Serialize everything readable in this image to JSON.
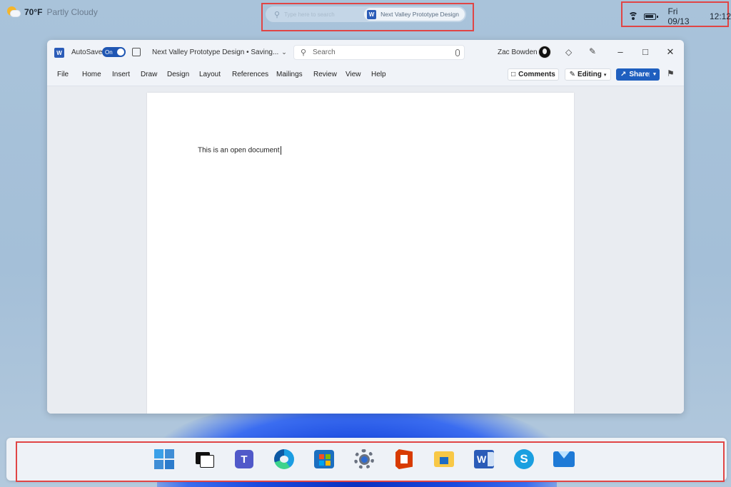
{
  "weather": {
    "temperature": "70°F",
    "condition": "Partly Cloudy"
  },
  "top_search": {
    "placeholder": "Type here to search",
    "active_doc": "Next Valley Prototype Design"
  },
  "tray": {
    "date": "Fri 09/13",
    "time": "12:12"
  },
  "word": {
    "autosave_label": "AutoSave",
    "autosave_state": "On",
    "doc_title": "Next Valley Prototype Design • Saving...",
    "search_placeholder": "Search",
    "user_name": "Zac Bowden",
    "menu": [
      "File",
      "Home",
      "Insert",
      "Draw",
      "Design",
      "Layout",
      "References",
      "Mailings",
      "Review",
      "View",
      "Help"
    ],
    "comments_label": "Comments",
    "editing_label": "Editing",
    "share_label": "Share",
    "document_text": "This is an open document"
  },
  "taskbar": {
    "icons": [
      "start-icon",
      "media-player-icon",
      "teams-icon",
      "edge-icon",
      "store-icon",
      "settings-icon",
      "office-icon",
      "file-explorer-icon",
      "word-icon",
      "skype-icon",
      "mail-icon"
    ]
  },
  "colors": {
    "accent": "#1f5fbf",
    "highlight_border": "#e04545",
    "word_brand": "#2b5cb8"
  }
}
